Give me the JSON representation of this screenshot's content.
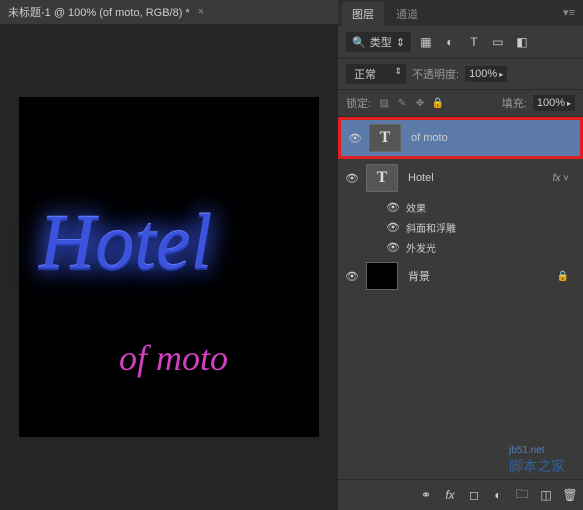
{
  "document": {
    "tab_title": "未标题-1 @ 100% (of moto, RGB/8) *",
    "canvas_text_main": "Hotel",
    "canvas_text_sub": "of moto"
  },
  "panel": {
    "tabs": {
      "layers": "图层",
      "channels": "通道"
    },
    "filter": {
      "kind": "类型"
    },
    "blend": {
      "mode": "正常",
      "opacity_label": "不透明度:",
      "opacity_value": "100%"
    },
    "lock": {
      "label": "锁定:",
      "fill_label": "填充:",
      "fill_value": "100%"
    }
  },
  "layers": [
    {
      "name": "of moto",
      "type": "text",
      "visible": true,
      "selected": true,
      "highlight": true
    },
    {
      "name": "Hotel",
      "type": "text",
      "visible": true,
      "fx": true,
      "effects": [
        {
          "label": "效果",
          "visible": true
        },
        {
          "label": "斜面和浮雕",
          "visible": true
        },
        {
          "label": "外发光",
          "visible": true
        }
      ]
    },
    {
      "name": "背景",
      "type": "bg",
      "visible": true,
      "locked": true
    }
  ],
  "watermark": {
    "url": "jb51.net",
    "cn": "脚本之家"
  }
}
